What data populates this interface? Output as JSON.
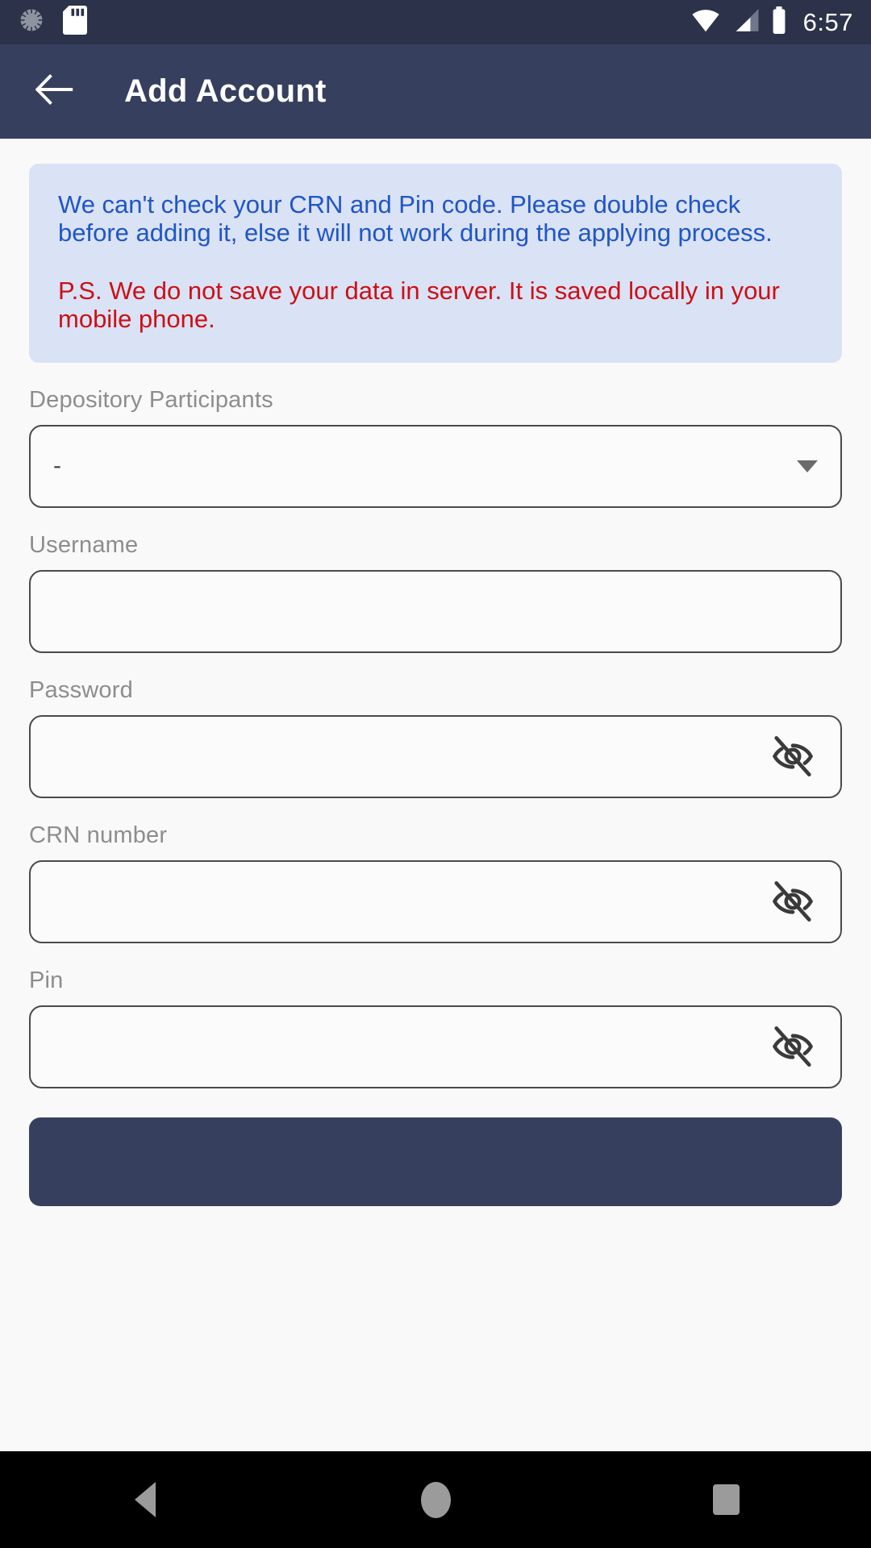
{
  "status_bar": {
    "icons_left": [
      "loading-circle-icon",
      "sd-card-icon"
    ],
    "icons_right": [
      "wifi-icon",
      "cellular-signal-icon",
      "battery-icon"
    ],
    "time": "6:57",
    "background_color": "#2b3249"
  },
  "app_bar": {
    "back_label": "back-arrow",
    "title": "Add Account",
    "background_color": "#36405e"
  },
  "banner": {
    "main_text": "We can't check your CRN and Pin code. Please double check before adding it, else it will not work during the applying process.",
    "ps_text": "P.S. We do not save your data in server. It is saved locally in your mobile phone.",
    "background_color": "#dae2f5",
    "main_color": "#1f56c8",
    "ps_color": "#cc1015"
  },
  "form": {
    "depository": {
      "label": "Depository Participants",
      "value": "-",
      "icon": "chevron-down-icon"
    },
    "username": {
      "label": "Username",
      "value": "",
      "placeholder": ""
    },
    "password": {
      "label": "Password",
      "value": "",
      "placeholder": "",
      "icon": "eye-off-icon"
    },
    "crn": {
      "label": "CRN number",
      "value": "",
      "placeholder": "",
      "icon": "eye-off-icon"
    },
    "pin": {
      "label": "Pin",
      "value": "",
      "placeholder": "",
      "icon": "eye-off-icon"
    },
    "submit": {
      "label": ""
    }
  },
  "nav_bar": {
    "back": "back-triangle-icon",
    "home": "home-circle-icon",
    "recents": "recents-square-icon",
    "background_color": "#000000"
  }
}
